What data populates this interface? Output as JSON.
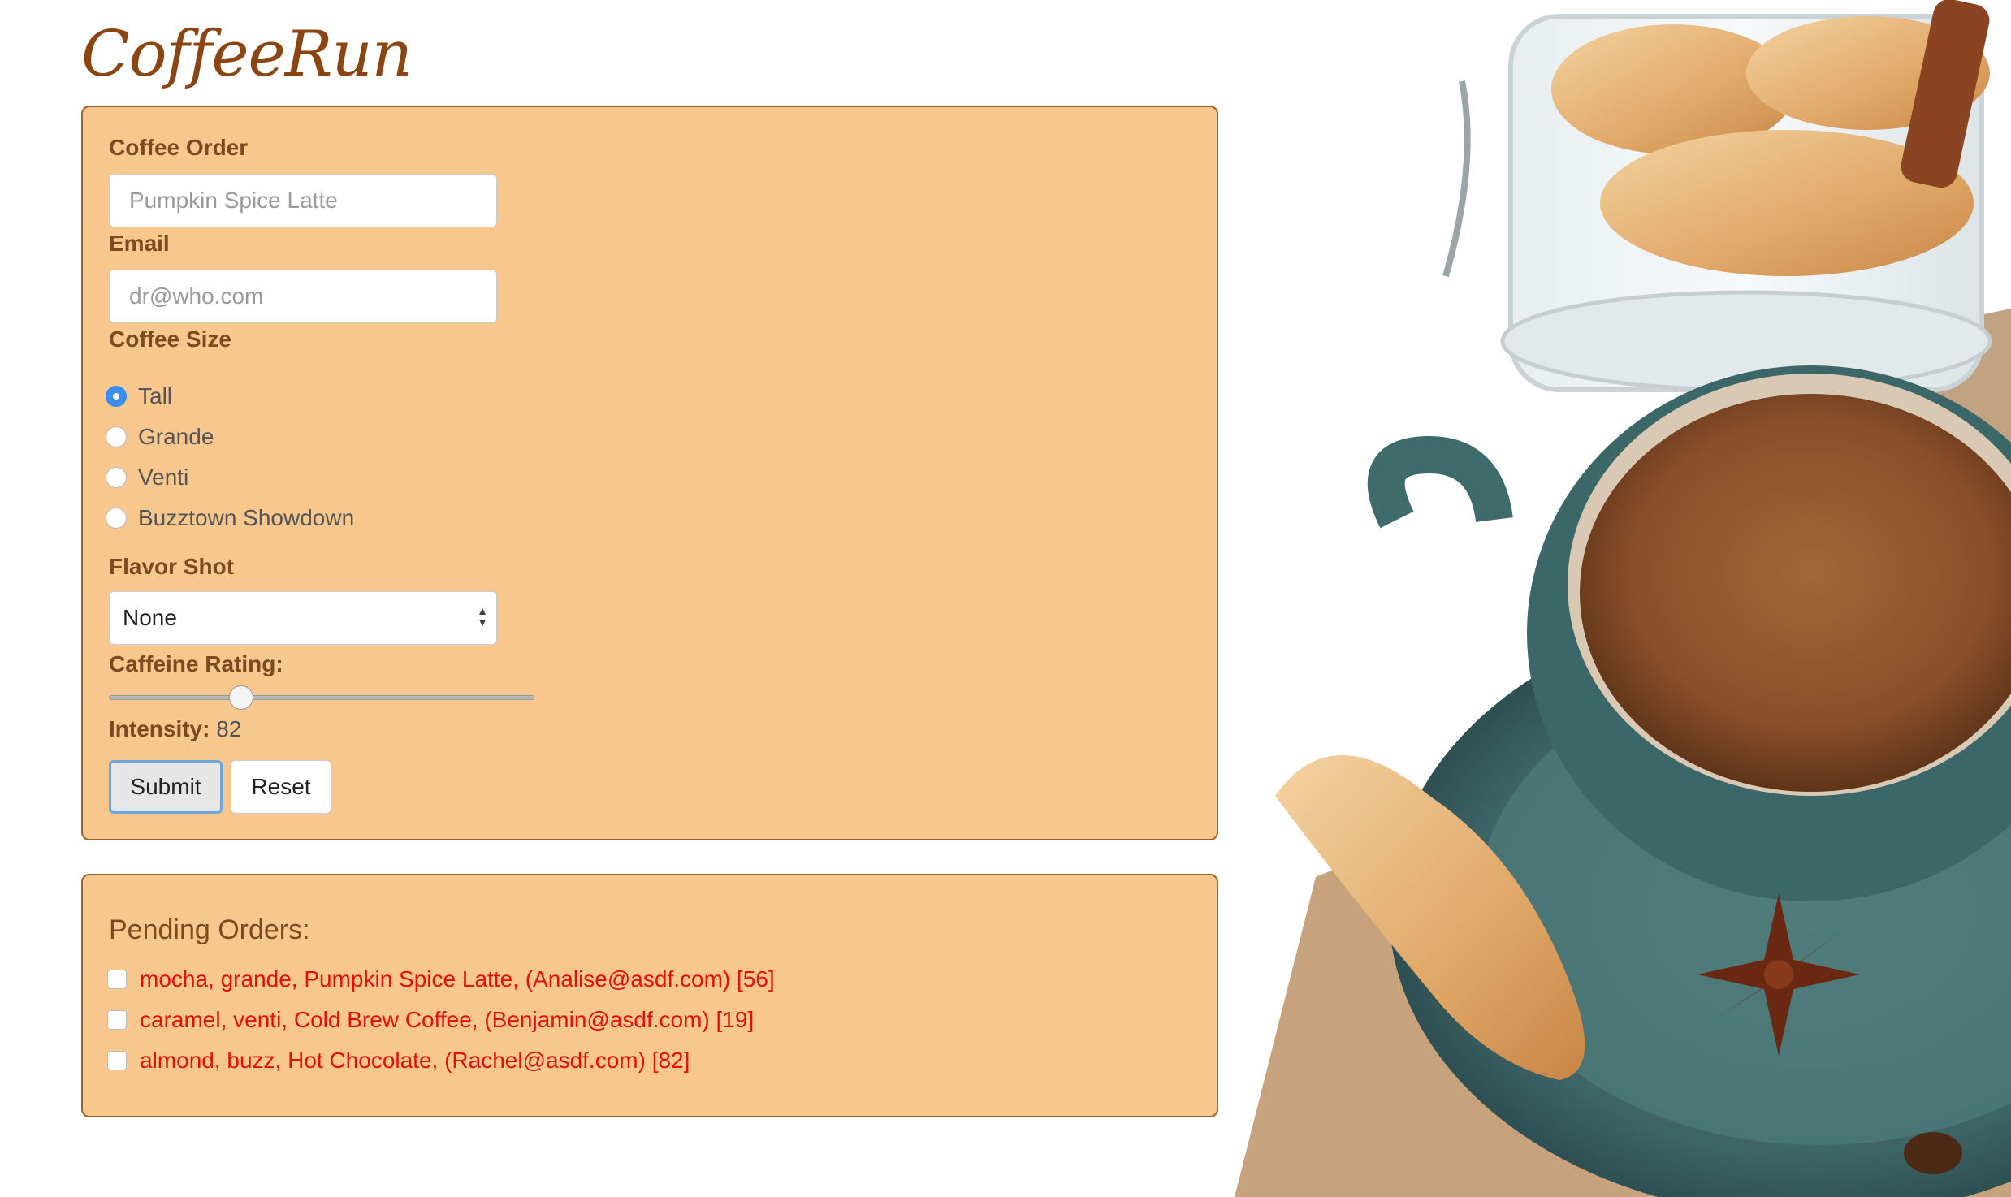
{
  "app": {
    "logo": "CoffeeRun"
  },
  "form": {
    "coffee_order": {
      "label": "Coffee Order",
      "placeholder": "Pumpkin Spice Latte"
    },
    "email": {
      "label": "Email",
      "placeholder": "dr@who.com"
    },
    "coffee_size": {
      "label": "Coffee Size",
      "options": [
        "Tall",
        "Grande",
        "Venti",
        "Buzztown Showdown"
      ],
      "selected": "Tall"
    },
    "flavor_shot": {
      "label": "Flavor Shot",
      "selected": "None"
    },
    "caffeine_rating": {
      "label": "Caffeine Rating:",
      "intensity_label": "Intensity:",
      "value": "82",
      "slider_fraction": 0.31
    },
    "buttons": {
      "submit": "Submit",
      "reset": "Reset"
    }
  },
  "pending": {
    "title": "Pending Orders:",
    "orders": [
      "mocha, grande, Pumpkin Spice Latte, (Analise@asdf.com) [56]",
      "caramel, venti, Cold Brew Coffee, (Benjamin@asdf.com) [19]",
      "almond, buzz, Hot Chocolate, (Rachel@asdf.com) [82]"
    ]
  },
  "colors": {
    "panel_bg": "#f7c78e",
    "panel_border": "#a0622d",
    "heading_brown": "#7b4a1e",
    "order_text_red": "#e31010",
    "radio_checked_blue": "#3b8cf0"
  },
  "photo": {
    "description_icon": "coffee-croissant-photo"
  }
}
